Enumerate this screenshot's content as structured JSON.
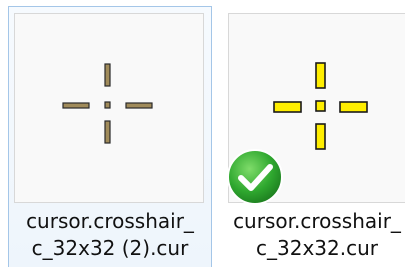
{
  "files": [
    {
      "name_line1": "cursor.crosshair_",
      "name_line2": "c_32x32 (2).cur",
      "icon": "crosshair-cursor-icon",
      "icon_color": "#a08b5a",
      "selected": true
    },
    {
      "name_line1": "cursor.crosshair_",
      "name_line2": "c_32x32.cur",
      "icon": "crosshair-cursor-icon",
      "icon_color": "#ffee00",
      "badge": "checkmark-icon",
      "badge_color": "#2fa82f"
    }
  ]
}
